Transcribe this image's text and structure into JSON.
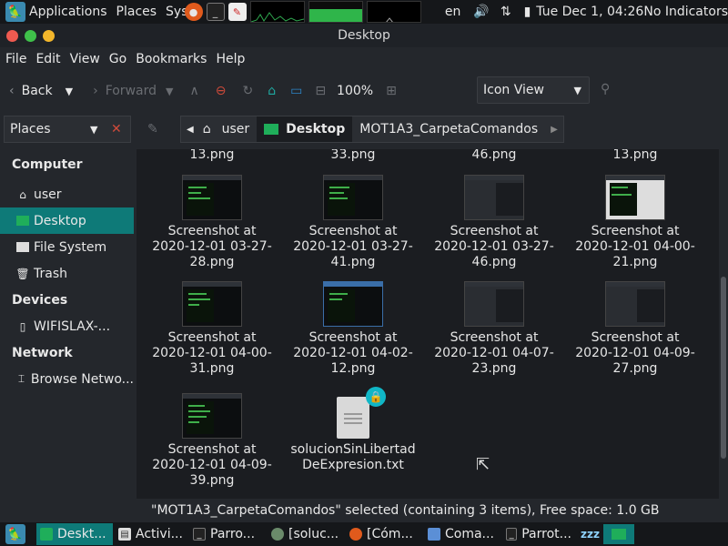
{
  "top_panel": {
    "menus": [
      "Applications",
      "Places",
      "Sys"
    ],
    "lang": "en",
    "clock": "Tue Dec  1, 04:26",
    "indicators": "No Indicators"
  },
  "window": {
    "title": "Desktop"
  },
  "menubar": [
    "File",
    "Edit",
    "View",
    "Go",
    "Bookmarks",
    "Help"
  ],
  "toolbar": {
    "back_label": "Back",
    "forward_label": "Forward",
    "zoom": "100%",
    "view_mode": "Icon View"
  },
  "location": {
    "places_label": "Places",
    "crumbs": [
      "user",
      "Desktop",
      "MOT1A3_CarpetaComandos"
    ]
  },
  "sidebar": {
    "computer_heading": "Computer",
    "computer_items": [
      "user",
      "Desktop",
      "File System",
      "Trash"
    ],
    "devices_heading": "Devices",
    "devices_items": [
      "WIFISLAX-..."
    ],
    "network_heading": "Network",
    "network_items": [
      "Browse Netwo..."
    ]
  },
  "files": {
    "partial_top": [
      "13.png",
      "33.png",
      "46.png",
      "13.png"
    ],
    "row1": [
      {
        "l1": "Screenshot at",
        "l2": "2020-12-01 03-27-",
        "l3": "28.png"
      },
      {
        "l1": "Screenshot at",
        "l2": "2020-12-01 03-27-",
        "l3": "41.png"
      },
      {
        "l1": "Screenshot at",
        "l2": "2020-12-01 03-27-",
        "l3": "46.png"
      },
      {
        "l1": "Screenshot at",
        "l2": "2020-12-01 04-00-",
        "l3": "21.png"
      }
    ],
    "row2": [
      {
        "l1": "Screenshot at",
        "l2": "2020-12-01 04-00-",
        "l3": "31.png"
      },
      {
        "l1": "Screenshot at",
        "l2": "2020-12-01 04-02-",
        "l3": "12.png"
      },
      {
        "l1": "Screenshot at",
        "l2": "2020-12-01 04-07-",
        "l3": "23.png"
      },
      {
        "l1": "Screenshot at",
        "l2": "2020-12-01 04-09-",
        "l3": "27.png"
      }
    ],
    "row3": [
      {
        "l1": "Screenshot at",
        "l2": "2020-12-01 04-09-",
        "l3": "39.png"
      },
      {
        "l1": "solucionSinLibertad",
        "l2": "DeExpresion.txt",
        "l3": ""
      }
    ]
  },
  "status": "\"MOT1A3_CarpetaComandos\" selected (containing 3 items), Free space: 1.0 GB",
  "taskbar": [
    "Deskt...",
    "Activi...",
    "Parro...",
    "[soluc...",
    "[Cóm...",
    "Coma...",
    "Parrot...",
    "zzz"
  ],
  "colors": {
    "accent": "#0e7a78",
    "lock_badge": "#10b6c6"
  }
}
